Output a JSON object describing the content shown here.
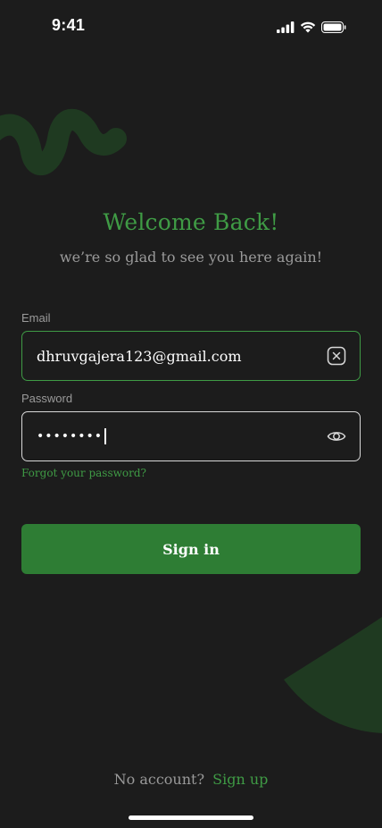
{
  "status_bar": {
    "time": "9:41",
    "icons": [
      "signal-icon",
      "wifi-icon",
      "battery-icon"
    ]
  },
  "header": {
    "title": "Welcome Back!",
    "subtitle": "we’re so glad to see you here again!"
  },
  "form": {
    "email": {
      "label": "Email",
      "value": "dhruvgajera123@gmail.com",
      "action_icon": "clear-icon"
    },
    "password": {
      "label": "Password",
      "masked_value": "••••••••",
      "action_icon": "eye-icon"
    },
    "forgot_label": "Forgot your password?",
    "submit_label": "Sign in"
  },
  "footer": {
    "prompt": "No account?",
    "link": "Sign up"
  },
  "colors": {
    "background": "#1c1c1c",
    "accent": "#3f9b45",
    "button": "#2e7d34",
    "muted_text": "#9a9a9a"
  }
}
